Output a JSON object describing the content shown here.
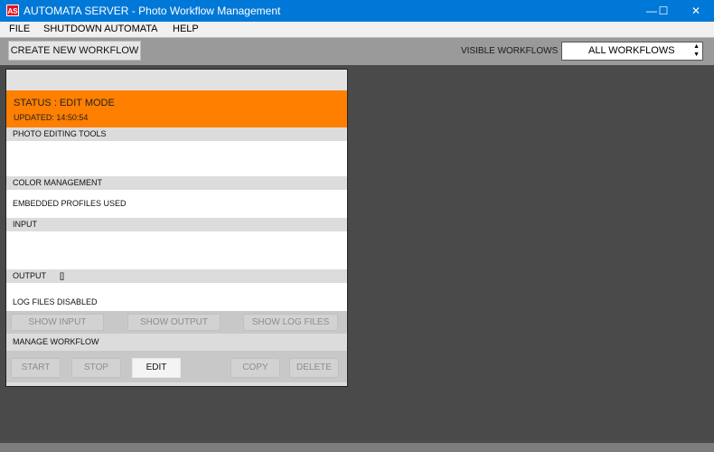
{
  "window": {
    "icon_text": "AS",
    "title": "AUTOMATA SERVER - Photo Workflow Management",
    "minimize": "—",
    "maximize": "☐",
    "close": "✕"
  },
  "menu": [
    "FILE",
    "SHUTDOWN AUTOMATA",
    "HELP"
  ],
  "toolbar": {
    "create_label": "CREATE NEW WORKFLOW",
    "visible_label": "VISIBLE WORKFLOWS",
    "visible_value": "ALL WORKFLOWS"
  },
  "workflow": {
    "status": "STATUS : EDIT MODE",
    "updated": "UPDATED: 14:50:54",
    "sections": {
      "photo_tools": "PHOTO EDITING TOOLS",
      "color_mgmt": "COLOR MANAGEMENT",
      "color_value": "EMBEDDED PROFILES USED",
      "input": "INPUT",
      "output": "OUTPUT",
      "output_value": "[]",
      "log_value": "LOG FILES DISABLED",
      "manage": "MANAGE WORKFLOW"
    },
    "show_buttons": {
      "show_input": "SHOW INPUT",
      "show_output": "SHOW OUTPUT",
      "show_log": "SHOW LOG FILES"
    },
    "manage_buttons": {
      "start": "START",
      "stop": "STOP",
      "edit": "EDIT",
      "copy": "COPY",
      "delete": "DELETE"
    }
  },
  "colors": {
    "titlebar": "#0078d7",
    "status_accent": "#ff7f00",
    "workspace": "#4a4a4a"
  }
}
